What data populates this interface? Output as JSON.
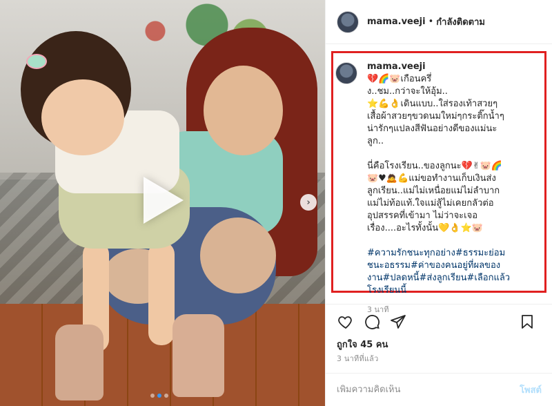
{
  "header": {
    "username": "mama.veeji",
    "separator": "•",
    "follow_status": "กำลังติดตาม"
  },
  "caption": {
    "username": "mama.veeji",
    "lines": [
      "💔🌈🐷เกือนครึ่",
      "ง..ชม..กว่าจะให้อุ้ม..",
      "⭐💪👌เดินแบบ..ใส่รองเท้าสวยๆ",
      "เสื้อผ้าสวยๆขวดนมใหม่ๆกระติ๊กน้ำๆ",
      "น่ารักๆแปลงสีฟันอย่างดีของแม่นะ",
      "ลูก.."
    ],
    "lines2": [
      "นี่คือโรงเรียน..ของลูกนะ💔✌🐷🌈",
      "🐷♥🙇💪แม่ขอทำงานเก็บเงินส่ง",
      "ลูกเรียน..แม่ไม่เหนื่อยแม่ไม่ลำบาก",
      "แม่ไม่ท้อแท้.ใจแม่สู้ไม่เคยกลัวต่อ",
      "อุปสรรคที่เข้ามา ไม่ว่าจะเจอ",
      "เรื่อง....อะไรทั้งนั้น💛👌⭐🐷"
    ],
    "hashtags": [
      "#ความรักชนะทุกอย่าง#ธรรมะย่อม",
      "ชนะอธรรม#ค่าของคนอยู่ที่ผลของ",
      "งาน#ปลดหนี้#ส่งลูกเรียน#เลือกแล้ว",
      "โรงเรียนนี้"
    ],
    "time": "3 นาที"
  },
  "actions": {
    "like_icon": "heart-icon",
    "comment_icon": "comment-icon",
    "share_icon": "share-icon",
    "save_icon": "bookmark-icon"
  },
  "likes": "ถูกใจ 45 คน",
  "post_time": "3 นาทีที่แล้ว",
  "comment": {
    "placeholder": "เพิ่มความคิดเห็น",
    "post_label": "โพสต์"
  },
  "media": {
    "play_icon": "play-icon",
    "next_icon": "chevron-right-icon",
    "next_glyph": "›",
    "slide_count": 3,
    "active_slide": 1
  },
  "colors": {
    "highlight_border": "#e02020",
    "hashtag": "#003569",
    "post_button": "#b2dffc"
  }
}
